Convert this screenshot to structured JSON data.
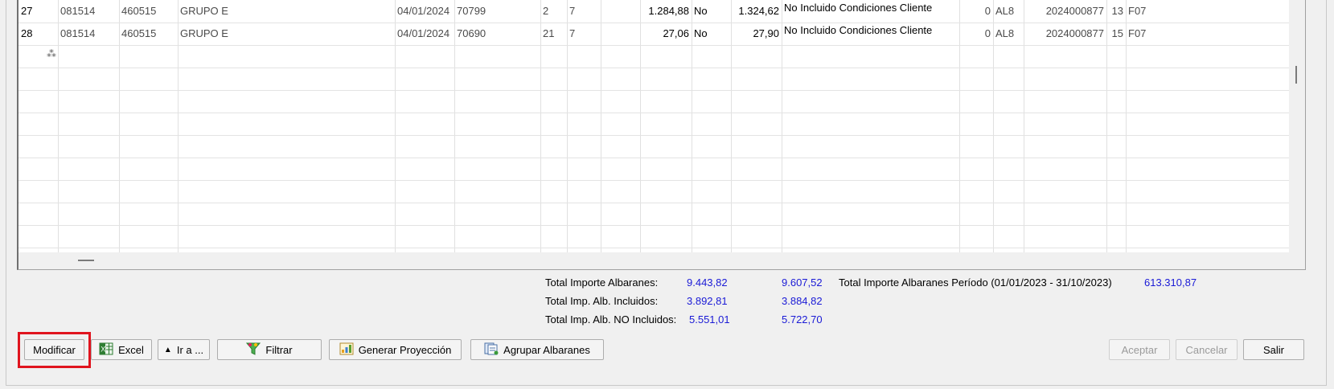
{
  "rows": [
    {
      "num": "27",
      "c1": "081514",
      "c2": "460515",
      "name": "GRUPO E",
      "date": "04/01/2024",
      "doc": "70799",
      "a": "2",
      "b": "7",
      "imp": "1.284,88",
      "flag": "No",
      "imp2": "1.324,62",
      "cond": "No Incluido Condiciones Cliente",
      "zero": "0",
      "al": "AL8",
      "ref": "2024000877",
      "n": "13",
      "f": "F07"
    },
    {
      "num": "28",
      "c1": "081514",
      "c2": "460515",
      "name": "GRUPO E",
      "date": "04/01/2024",
      "doc": "70690",
      "a": "21",
      "b": "7",
      "imp": "27,06",
      "flag": "No",
      "imp2": "27,90",
      "cond": "No Incluido Condiciones Cliente",
      "zero": "0",
      "al": "AL8",
      "ref": "2024000877",
      "n": "15",
      "f": "F07"
    }
  ],
  "new_row_icon": "asterisk-new-row-icon",
  "totals": {
    "importe_label": "Total Importe Albaranes:",
    "importe_v1": "9.443,82",
    "importe_v2": "9.607,52",
    "incluidos_label": "Total Imp. Alb. Incluidos:",
    "incluidos_v1": "3.892,81",
    "incluidos_v2": "3.884,82",
    "no_incluidos_label": "Total Imp. Alb. NO Incluidos:",
    "no_incluidos_v1": "5.551,01",
    "no_incluidos_v2": "5.722,70",
    "periodo_label": "Total Importe Albaranes Período (01/01/2023 - 31/10/2023)",
    "periodo_value": "613.310,87"
  },
  "buttons": {
    "modificar": "Modificar",
    "excel": "Excel",
    "ir_a": "Ir a ...",
    "filtrar": "Filtrar",
    "generar": "Generar Proyección",
    "agrupar": "Agrupar Albaranes",
    "aceptar": "Aceptar",
    "cancelar": "Cancelar",
    "salir": "Salir"
  },
  "colors": {
    "totals_blue": "#1a1ad6",
    "highlight_red": "#e0141e"
  }
}
